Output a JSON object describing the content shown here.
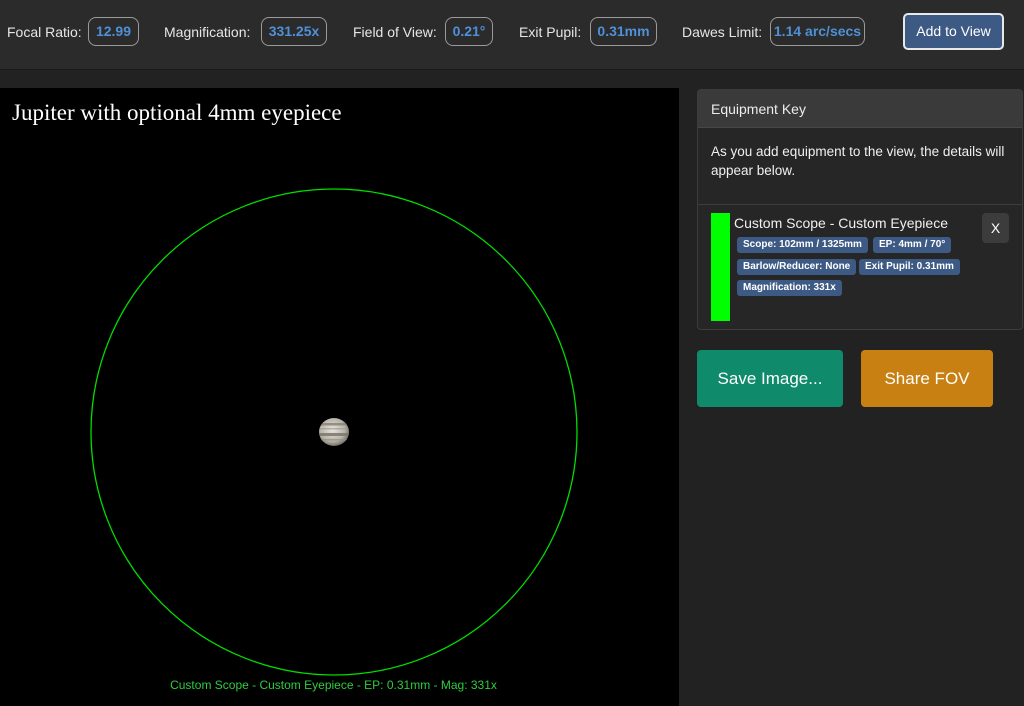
{
  "stats": {
    "focal_ratio": {
      "label": "Focal Ratio:",
      "value": "12.99"
    },
    "magnification": {
      "label": "Magnification:",
      "value": "331.25x"
    },
    "field_of_view": {
      "label": "Field of View:",
      "value": "0.21°"
    },
    "exit_pupil": {
      "label": "Exit Pupil:",
      "value": "0.31mm"
    },
    "dawes_limit": {
      "label": "Dawes Limit:",
      "value": "1.14 arc/secs"
    }
  },
  "add_button_label": "Add to View",
  "view": {
    "title": "Jupiter with optional 4mm eyepiece",
    "caption": "Custom Scope - Custom Eyepiece - EP: 0.31mm - Mag: 331x",
    "circle_color": "#00dd00",
    "planet_icon": "jupiter-icon"
  },
  "equipment_key": {
    "header": "Equipment Key",
    "description": "As you add equipment to the view, the details will appear below.",
    "entries": [
      {
        "title": "Custom Scope - Custom Eyepiece",
        "color": "#00ff00",
        "badges": [
          "Scope: 102mm / 1325mm",
          "EP: 4mm / 70°",
          "Barlow/Reducer: None",
          "Exit Pupil: 0.31mm",
          "Magnification: 331x"
        ],
        "remove_label": "X"
      }
    ]
  },
  "actions": {
    "save_label": "Save Image...",
    "share_label": "Share FOV"
  },
  "colors": {
    "accent_blue": "#3d5a84",
    "value_blue": "#4f90d6",
    "save_green": "#0f8a6b",
    "share_orange": "#c98013"
  }
}
